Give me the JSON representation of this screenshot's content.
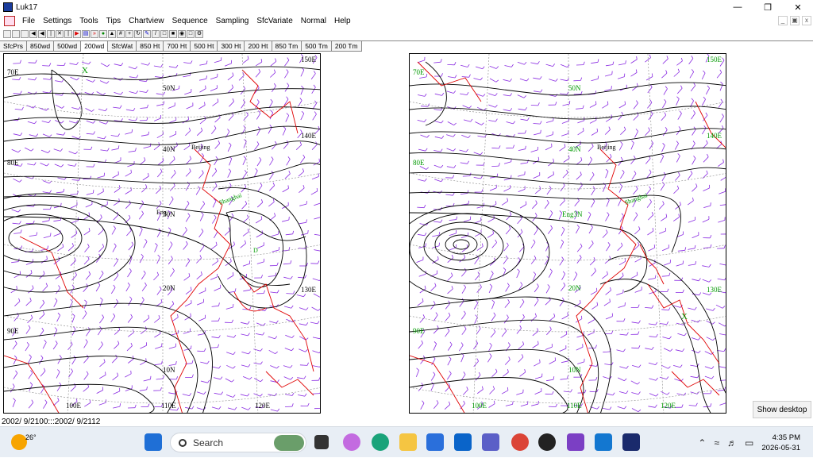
{
  "window": {
    "title": "Luk17"
  },
  "menu": [
    "File",
    "Settings",
    "Tools",
    "Tips",
    "Chartview",
    "Sequence",
    "Sampling",
    "SfcVariate",
    "Normal",
    "Help"
  ],
  "tabs": [
    "SfcPrs",
    "850wd",
    "500wd",
    "200wd",
    "SfcWat",
    "850 Ht",
    "700 Ht",
    "500 Ht",
    "300 Ht",
    "200 Ht",
    "850 Tm",
    "500 Tm",
    "200 Tm"
  ],
  "active_tab": "200wd",
  "map_left": {
    "lat_labels": [
      "50N",
      "40N",
      "30N",
      "20N",
      "10N"
    ],
    "lon_labels": [
      "70E",
      "80E",
      "90E",
      "100E",
      "110E",
      "120E",
      "130E",
      "140E",
      "150E"
    ],
    "places": [
      "Beijing",
      "Shanghai",
      "Eng"
    ],
    "marker": "X",
    "center_marker": "D"
  },
  "map_right": {
    "lat_labels": [
      "50N",
      "40N",
      "20N",
      "10N"
    ],
    "lat_label_30": "Eng3N",
    "lon_labels": [
      "70E",
      "80E",
      "90E",
      "100E",
      "110E",
      "120E",
      "130E",
      "140E",
      "150E"
    ],
    "places": [
      "Beijing",
      "Shanghai"
    ],
    "marker": "X"
  },
  "status": "2002/ 9/2100:::2002/ 9/2112",
  "show_desktop": "Show desktop",
  "taskbar": {
    "temperature": "26°",
    "search_placeholder": "Search",
    "time": "4:35 PM",
    "date": "2026-05-31"
  },
  "colors": {
    "contour": "#000000",
    "wind": "#8a2be2",
    "coast": "#e00000",
    "label_left": "#000000",
    "label_right": "#009900"
  }
}
